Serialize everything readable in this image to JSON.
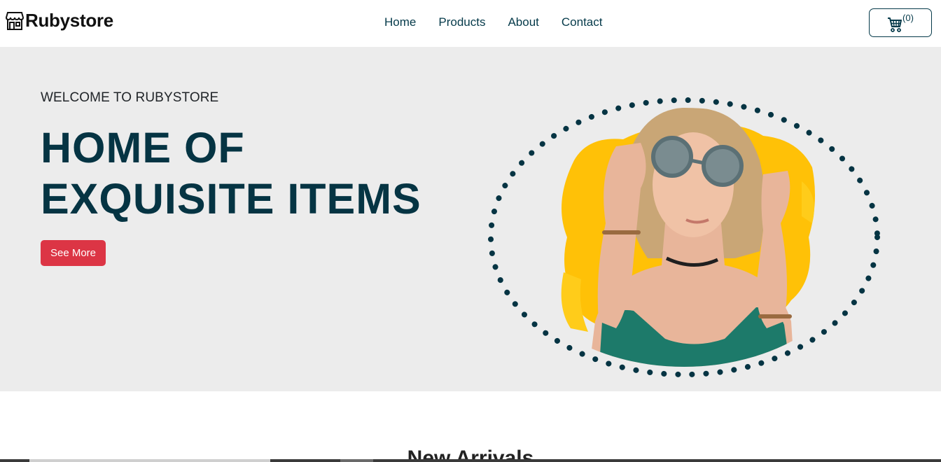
{
  "brand": {
    "name": "Rubystore",
    "icon": "store-icon"
  },
  "nav": {
    "items": [
      {
        "label": "Home"
      },
      {
        "label": "Products"
      },
      {
        "label": "About"
      },
      {
        "label": "Contact"
      }
    ]
  },
  "cart": {
    "icon": "cart-icon",
    "count_label": "(0)"
  },
  "hero": {
    "eyebrow": "WELCOME TO RUBYSTORE",
    "headline_line1": "HOME OF",
    "headline_line2": "EXQUISITE ITEMS",
    "cta_label": "See More",
    "image_desc": "model-with-sunglasses-photo"
  },
  "section": {
    "title": "New Arrivals"
  },
  "colors": {
    "accent": "#dc3545",
    "brand_dark": "#053443",
    "hero_bg": "#ececec",
    "highlight_yellow": "#ffc107"
  }
}
